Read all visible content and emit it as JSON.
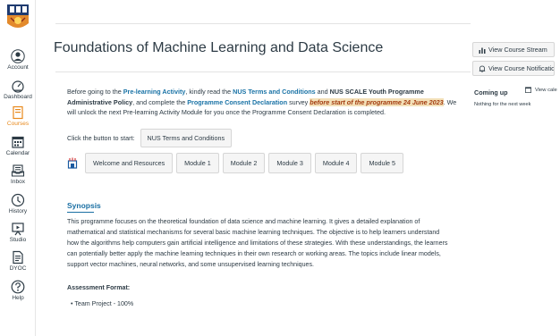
{
  "nav": {
    "items": [
      {
        "label": "Account",
        "icon": "account-icon"
      },
      {
        "label": "Dashboard",
        "icon": "dashboard-icon"
      },
      {
        "label": "Courses",
        "icon": "courses-icon",
        "active": true
      },
      {
        "label": "Calendar",
        "icon": "calendar-icon"
      },
      {
        "label": "Inbox",
        "icon": "inbox-icon"
      },
      {
        "label": "History",
        "icon": "history-icon"
      },
      {
        "label": "Studio",
        "icon": "studio-icon"
      },
      {
        "label": "DYOC",
        "icon": "dyoc-icon"
      },
      {
        "label": "Help",
        "icon": "help-icon"
      }
    ],
    "active_color": "#e8891c"
  },
  "course": {
    "title": "Foundations of Machine Learning and Data Science"
  },
  "intro": {
    "t1": "Before going to the ",
    "link1": "Pre-learning Activity",
    "t2": ", kindly read the ",
    "link2": "NUS Terms and Conditions",
    "t3": " and ",
    "link3": "NUS SCALE Youth Programme Administrative Policy",
    "t4": ", and complete the ",
    "link4": "Programme Consent Declaration",
    "t5": " survey ",
    "highlight": "before start of the programme 24 June 2023",
    "t6": ". We will unlock the next Pre-learning Activity Module for you once the Programme Consent Declaration is completed."
  },
  "start": {
    "label": "Click the button to start:",
    "button": "NUS Terms and Conditions"
  },
  "modules": [
    "Welcome and Resources",
    "Module 1",
    "Module 2",
    "Module 3",
    "Module 4",
    "Module 5"
  ],
  "synopsis": {
    "heading": "Synopsis",
    "body": "This programme focuses on the theoretical foundation of data science and machine learning. It gives a detailed explanation of mathematical and statistical mechanisms for several basic machine learning techniques. The objective is to help learners understand how the algorithms help computers gain artificial intelligence and limitations of these strategies. With these understandings, the learners can potentially better apply the machine learning techniques in their own research or working areas. The topics include linear models, support vector machines, neural networks, and some unsupervised learning techniques.",
    "assessment_heading": "Assessment Format:",
    "assessment_items": [
      "Team Project - 100%"
    ]
  },
  "sidebar": {
    "stream_button": "View Course Stream",
    "notif_button": "View Course Notifications",
    "coming_up": "Coming up",
    "view_calendar": "View cale",
    "nothing": "Nothing for the next week"
  },
  "colors": {
    "link": "#1a73a6",
    "heading_blue": "#1a6fa3",
    "highlight_bg": "#f3e0b8",
    "highlight_text": "#a33c10"
  }
}
